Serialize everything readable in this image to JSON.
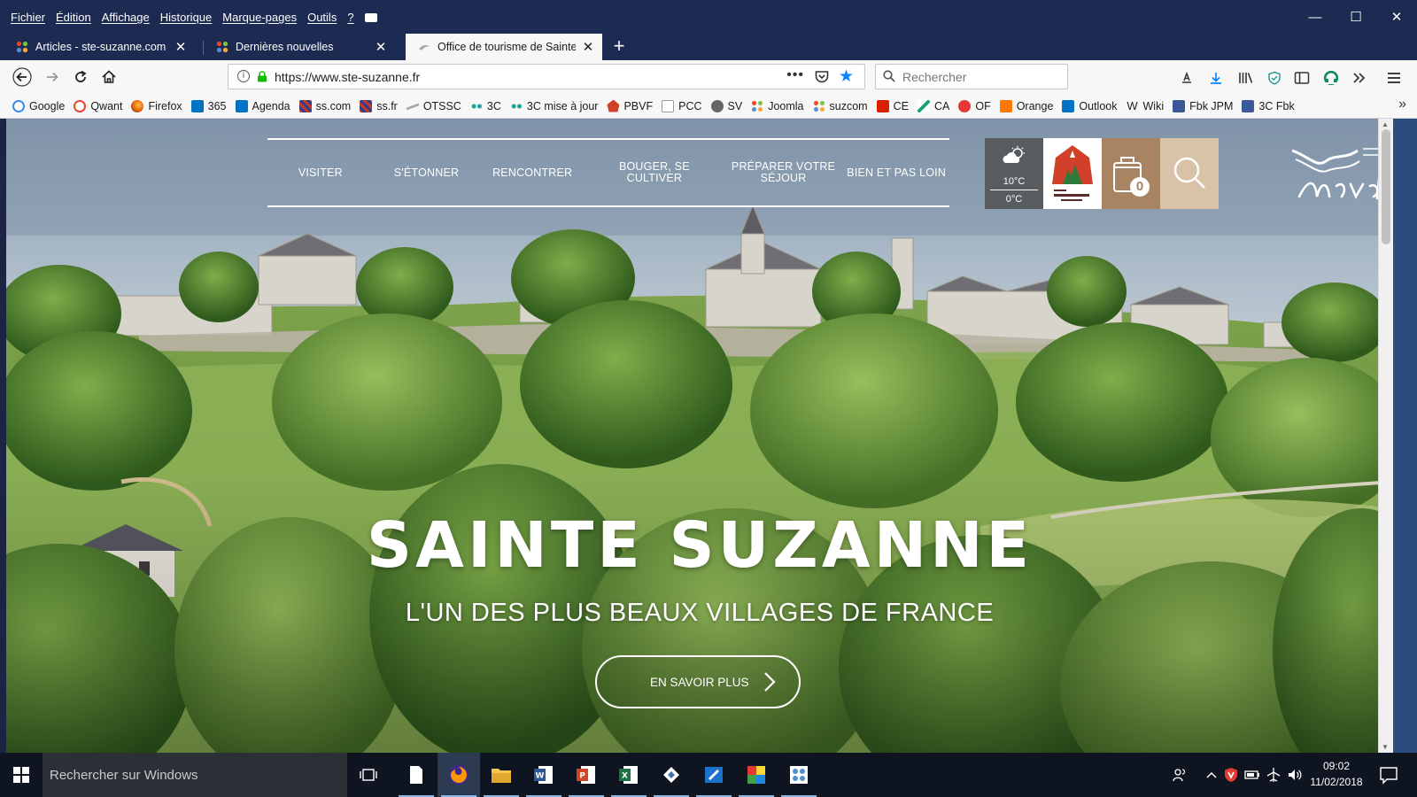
{
  "menubar": {
    "items": [
      "Fichier",
      "Édition",
      "Affichage",
      "Historique",
      "Marque-pages",
      "Outils",
      "?"
    ],
    "window_controls": [
      "—",
      "☐",
      "✕"
    ]
  },
  "tabs": [
    {
      "title": "Articles - ste-suzanne.com - Ad",
      "close": "✕"
    },
    {
      "title": "Dernières nouvelles",
      "close": "✕"
    },
    {
      "title": "Office de tourisme de Sainte Su",
      "close": "✕"
    }
  ],
  "toolbar": {
    "new_tab": "+",
    "url": "https://www.ste-suzanne.fr",
    "url_more": "•••",
    "search_placeholder": "Rechercher"
  },
  "bookmarks": [
    {
      "label": "Google",
      "color": "#4285f4"
    },
    {
      "label": "Qwant",
      "color": "#e8463a"
    },
    {
      "label": "Firefox",
      "color": "#e66000"
    },
    {
      "label": "365",
      "color": "#0072c6"
    },
    {
      "label": "Agenda",
      "color": "#0072c6"
    },
    {
      "label": "ss.com",
      "color": "#c0392b"
    },
    {
      "label": "ss.fr",
      "color": "#c0392b"
    },
    {
      "label": "OTSSC",
      "color": "#9aa0a6"
    },
    {
      "label": "3C",
      "color": "#1aa39a"
    },
    {
      "label": "3C mise à jour",
      "color": "#1aa39a"
    },
    {
      "label": "PBVF",
      "color": "#d0402b"
    },
    {
      "label": "PCC",
      "color": "#9aa0a6"
    },
    {
      "label": "SV",
      "color": "#555555"
    },
    {
      "label": "Joomla",
      "color": "#f44321"
    },
    {
      "label": "suzcom",
      "color": "#5091cd"
    },
    {
      "label": "CE",
      "color": "#d81e05"
    },
    {
      "label": "CA",
      "color": "#1aa37a"
    },
    {
      "label": "OF",
      "color": "#e53935"
    },
    {
      "label": "Orange",
      "color": "#ff7900"
    },
    {
      "label": "Outlook",
      "color": "#0072c6"
    },
    {
      "label": "Wiki",
      "color": "#222222"
    },
    {
      "label": "Fbk JPM",
      "color": "#3b5998"
    },
    {
      "label": "3C Fbk",
      "color": "#3b5998"
    }
  ],
  "bookmarks_overflow": "»",
  "site": {
    "nav": [
      "VISITER",
      "S'ÉTONNER",
      "RENCONTRER",
      "BOUGER, SE CULTIVER",
      "PRÉPARER VOTRE SÉJOUR",
      "BIEN ET PAS LOIN"
    ],
    "weather": {
      "max": "10°C",
      "min": "0°C"
    },
    "cart_count": "0",
    "hero_title": "SAINTE SUZANNE",
    "hero_subtitle": "L'UN DES PLUS BEAUX VILLAGES DE FRANCE",
    "cta_label": "EN SAVOIR PLUS"
  },
  "taskbar": {
    "search_placeholder": "Rechercher sur Windows",
    "time": "09:02",
    "date": "11/02/2018"
  },
  "colors": {
    "browser_chrome": "#1d2a52",
    "toolbar_bg": "#f7f7f8",
    "accent_blue": "#0a84ff",
    "cart_brown": "#a98462",
    "search_sand": "#d8c2a8",
    "weather_grey": "#5a5d60"
  }
}
